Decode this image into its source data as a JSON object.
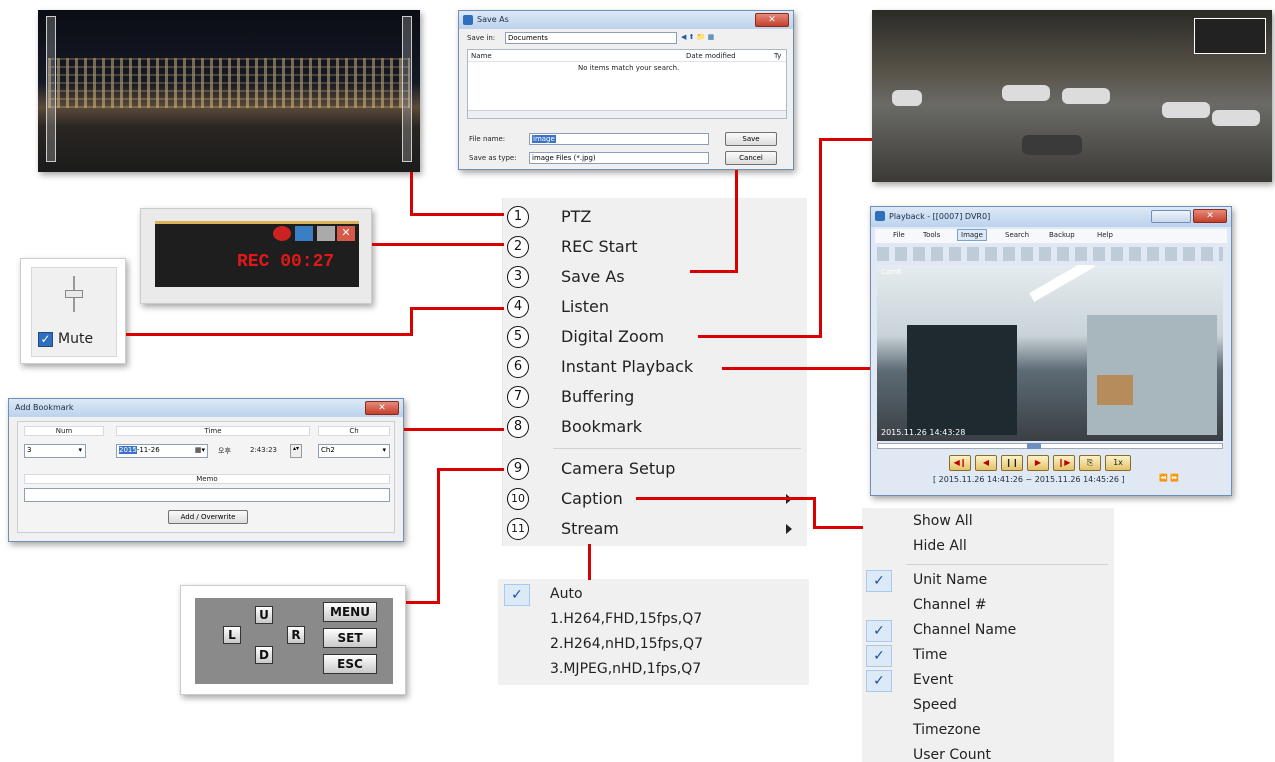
{
  "main_menu": {
    "items": [
      {
        "num": "1",
        "label": "PTZ"
      },
      {
        "num": "2",
        "label": "REC Start"
      },
      {
        "num": "3",
        "label": "Save As"
      },
      {
        "num": "4",
        "label": "Listen"
      },
      {
        "num": "5",
        "label": "Digital Zoom"
      },
      {
        "num": "6",
        "label": "Instant Playback"
      },
      {
        "num": "7",
        "label": "Buffering"
      },
      {
        "num": "8",
        "label": "Bookmark"
      },
      {
        "num": "9",
        "label": "Camera Setup"
      },
      {
        "num": "10",
        "label": "Caption"
      },
      {
        "num": "11",
        "label": "Stream"
      }
    ]
  },
  "stream_submenu": {
    "items": [
      {
        "label": "Auto",
        "checked": true
      },
      {
        "label": "1.H264,FHD,15fps,Q7",
        "checked": false
      },
      {
        "label": "2.H264,nHD,15fps,Q7",
        "checked": false
      },
      {
        "label": "3.MJPEG,nHD,1fps,Q7",
        "checked": false
      }
    ]
  },
  "caption_submenu": {
    "items": [
      {
        "label": "Show All",
        "checked": false
      },
      {
        "label": "Hide All",
        "checked": false
      },
      {
        "label": "Unit Name",
        "checked": true
      },
      {
        "label": "Channel #",
        "checked": false
      },
      {
        "label": "Channel Name",
        "checked": true
      },
      {
        "label": "Time",
        "checked": true
      },
      {
        "label": "Event",
        "checked": true
      },
      {
        "label": "Speed",
        "checked": false
      },
      {
        "label": "Timezone",
        "checked": false
      },
      {
        "label": "User Count",
        "checked": false
      }
    ]
  },
  "save_as": {
    "title": "Save As",
    "save_in_label": "Save in:",
    "save_in_value": "Documents",
    "col_name": "Name",
    "col_date": "Date modified",
    "col_type": "Ty",
    "empty_msg": "No items match your search.",
    "file_name_label": "File name:",
    "file_name_value": "image",
    "save_type_label": "Save as type:",
    "save_type_value": "image Files (*.jpg)",
    "save_button": "Save",
    "cancel_button": "Cancel"
  },
  "rec_panel": {
    "rec_text": "REC 00:27"
  },
  "listen_panel": {
    "mute_label": "Mute",
    "mute_checked": true
  },
  "bookmark": {
    "title": "Add Bookmark",
    "col_num": "Num",
    "col_time": "Time",
    "col_ch": "Ch",
    "num_value": "3",
    "date_highlight": "2015",
    "date_rest": "-11-26",
    "ampm": "오후",
    "time_value": "2:43:23",
    "ch_value": "Ch2",
    "memo_label": "Memo",
    "button": "Add / Overwrite"
  },
  "keypad": {
    "up": "U",
    "down": "D",
    "left": "L",
    "right": "R",
    "menu": "MENU",
    "set": "SET",
    "esc": "ESC"
  },
  "playback": {
    "title": "Playback - [[0007] DVR0]",
    "menus": [
      "File",
      "Tools",
      "Image",
      "Search",
      "Backup",
      "Help"
    ],
    "camera_label": "Cam6",
    "timestamp": "2015.11.26 14:43:28",
    "range": "[ 2015.11.26 14:41:26 ~ 2015.11.26 14:45:26 ]",
    "speed": "1x",
    "progress": 0.45
  },
  "colors": {
    "connector": "#d80000",
    "check_bg": "#dceaf8",
    "menu_bg": "#f0f0f0"
  }
}
